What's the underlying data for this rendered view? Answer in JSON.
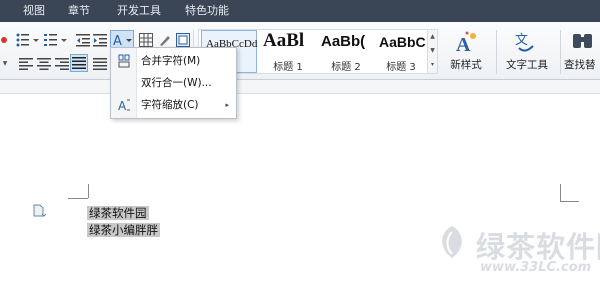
{
  "menu_bar": {
    "items": [
      "视图",
      "章节",
      "开发工具",
      "特色功能"
    ]
  },
  "ribbon": {
    "styles_gallery": {
      "items": [
        {
          "sample": "AaBbCcDd",
          "name": ""
        },
        {
          "sample": "AaBl",
          "name": "标题 1"
        },
        {
          "sample": "AaBb(",
          "name": "标题 2"
        },
        {
          "sample": "AaBbC",
          "name": "标题 3"
        }
      ]
    },
    "buttons": {
      "new_style": "新样式",
      "text_tools": "文字工具",
      "find_replace": "查找替"
    }
  },
  "dropdown_menu": {
    "items": [
      {
        "label": "合并字符(M)",
        "icon": "merge-characters-icon",
        "has_submenu": false
      },
      {
        "label": "双行合一(W)...",
        "icon": "",
        "has_submenu": false
      },
      {
        "label": "字符缩放(C)",
        "icon": "character-scale-icon",
        "has_submenu": true
      }
    ],
    "submenu_arrow": "▸"
  },
  "document": {
    "lines": [
      "绿茶软件园",
      "绿茶小编胖胖"
    ]
  },
  "watermark": {
    "title": "绿茶软件园",
    "url": "www.33LC.com"
  },
  "colors": {
    "menubar_bg": "#3a4555",
    "selection_highlight": "#c8c8c8",
    "active_button_bg": "#cfe3f7"
  }
}
